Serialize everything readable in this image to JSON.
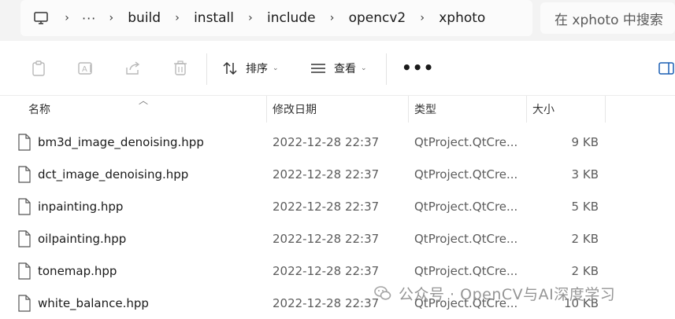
{
  "address": {
    "pc_icon": "monitor-icon",
    "more": "···",
    "crumbs": [
      "build",
      "install",
      "include",
      "opencv2",
      "xphoto"
    ]
  },
  "search": {
    "placeholder": "在 xphoto 中搜索"
  },
  "toolbar": {
    "sort_label": "排序",
    "view_label": "查看",
    "more": "•••",
    "icons": [
      "clipboard-icon",
      "rename-icon",
      "share-icon",
      "delete-icon",
      "sort-icon",
      "view-icon",
      "details-pane-icon"
    ]
  },
  "columns": {
    "name": "名称",
    "date": "修改日期",
    "type": "类型",
    "size": "大小"
  },
  "files": [
    {
      "name": "bm3d_image_denoising.hpp",
      "date": "2022-12-28 22:37",
      "type": "QtProject.QtCre...",
      "size": "9 KB"
    },
    {
      "name": "dct_image_denoising.hpp",
      "date": "2022-12-28 22:37",
      "type": "QtProject.QtCre...",
      "size": "3 KB"
    },
    {
      "name": "inpainting.hpp",
      "date": "2022-12-28 22:37",
      "type": "QtProject.QtCre...",
      "size": "5 KB"
    },
    {
      "name": "oilpainting.hpp",
      "date": "2022-12-28 22:37",
      "type": "QtProject.QtCre...",
      "size": "2 KB"
    },
    {
      "name": "tonemap.hpp",
      "date": "2022-12-28 22:37",
      "type": "QtProject.QtCre...",
      "size": "2 KB"
    },
    {
      "name": "white_balance.hpp",
      "date": "2022-12-28 22:37",
      "type": "QtProject.QtCre...",
      "size": "10 KB"
    }
  ],
  "watermark": {
    "text": "公众号 · OpenCV与AI深度学习"
  }
}
